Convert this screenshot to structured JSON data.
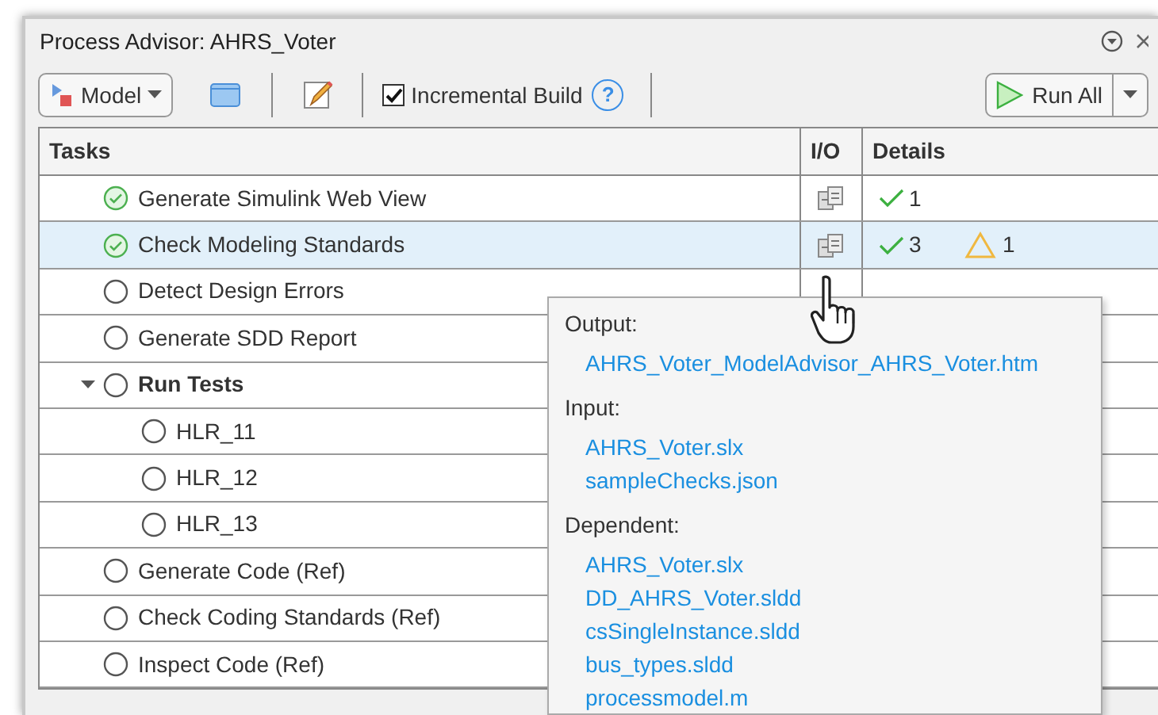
{
  "window": {
    "title": "Process Advisor: AHRS_Voter"
  },
  "toolbar": {
    "model_button": "Model",
    "incremental_build": {
      "label": "Incremental Build",
      "checked": true
    },
    "help": "?",
    "run_button": "Run All"
  },
  "table": {
    "columns": [
      "Tasks",
      "I/O",
      "Details"
    ],
    "tasks": [
      {
        "name": "Generate Simulink Web View",
        "completed": true,
        "selected": false,
        "details": {
          "passed": "1"
        }
      },
      {
        "name": "Check Modeling Standards",
        "completed": true,
        "selected": true,
        "details": {
          "passed": "3",
          "warnings": "1"
        }
      },
      {
        "name": "Detect Design Errors",
        "completed": false,
        "selected": false
      },
      {
        "name": "Generate SDD Report",
        "completed": false,
        "selected": false
      },
      {
        "name": "Run Tests",
        "completed": false,
        "selected": false,
        "expanded": true,
        "children": [
          {
            "name": "HLR_11",
            "completed": false,
            "selected": false
          },
          {
            "name": "HLR_12",
            "completed": false,
            "selected": false
          },
          {
            "name": "HLR_13",
            "completed": false,
            "selected": false
          }
        ]
      },
      {
        "name": "Generate Code (Ref)",
        "completed": false,
        "selected": false
      },
      {
        "name": "Check Coding Standards (Ref)",
        "completed": false,
        "selected": false
      },
      {
        "name": "Inspect Code (Ref)",
        "completed": false,
        "selected": false
      }
    ]
  },
  "io_popup": {
    "sections": [
      {
        "heading": "Output:",
        "links": [
          "AHRS_Voter_ModelAdvisor_AHRS_Voter.htm"
        ]
      },
      {
        "heading": "Input:",
        "links": [
          "AHRS_Voter.slx",
          "sampleChecks.json"
        ]
      },
      {
        "heading": "Dependent:",
        "links": [
          "AHRS_Voter.slx",
          "DD_AHRS_Voter.sldd",
          "csSingleInstance.sldd",
          "bus_types.sldd",
          "processmodel.m"
        ]
      }
    ]
  }
}
